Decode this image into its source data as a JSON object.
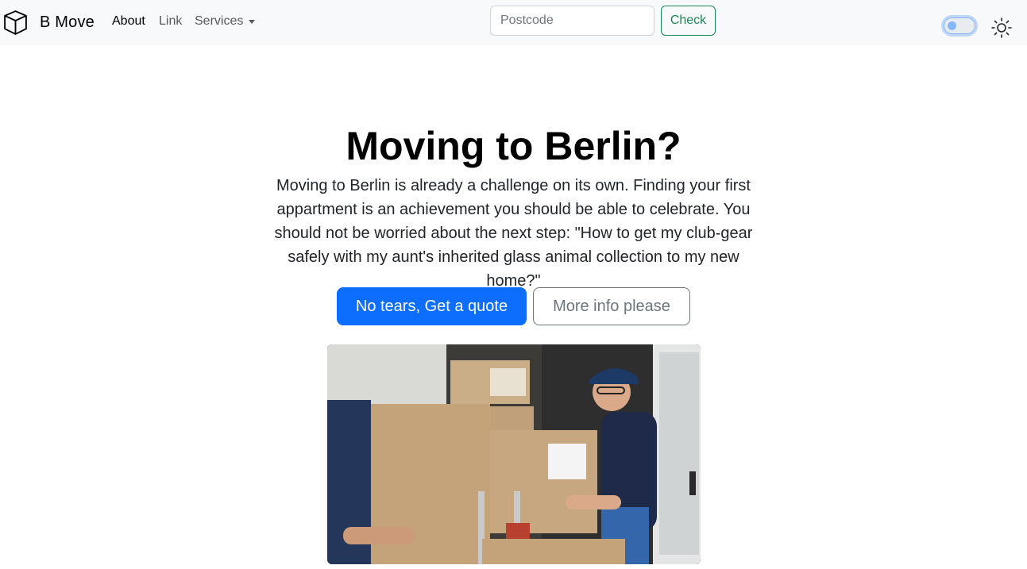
{
  "navbar": {
    "brand": "B Move",
    "links": [
      {
        "label": "About",
        "active": true
      },
      {
        "label": "Link",
        "active": false
      },
      {
        "label": "Services",
        "active": false
      }
    ],
    "postcode_placeholder": "Postcode",
    "check_label": "Check",
    "icons": [
      "box-icon",
      "theme-toggle",
      "sun-icon"
    ]
  },
  "hero": {
    "title": "Moving to Berlin?",
    "text": "Moving to Berlin is already a challenge on its own. Finding your first appartment is an achievement you should be able to celebrate. You should not be worried about the next step: \"How to get my club-gear safely with my aunt's inherited glass animal collection to my new home?\"",
    "primary_button": "No tears, Get a quote",
    "secondary_button": "More info please"
  },
  "colors": {
    "primary": "#0d6efd",
    "success": "#198754",
    "secondary": "#6c757d",
    "navbar_bg": "#f8f9fa"
  }
}
